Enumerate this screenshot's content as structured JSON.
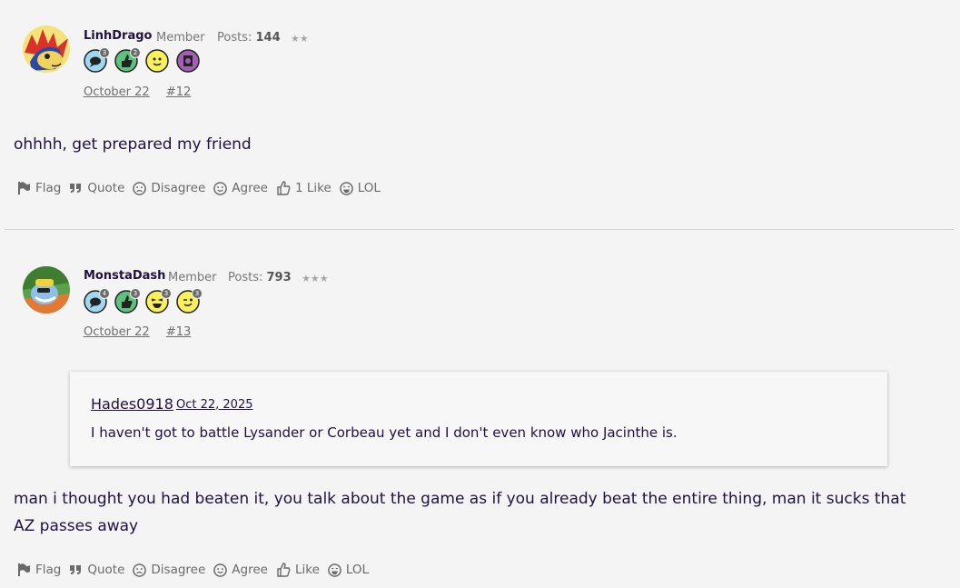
{
  "posts": [
    {
      "username": "LinhDrago",
      "role": "Member",
      "posts_label": "Posts:",
      "posts_count": "144",
      "stars": "★★",
      "badges": [
        {
          "icon": "speech-bubble-badge-icon",
          "count": "3"
        },
        {
          "icon": "thumbs-up-badge-icon",
          "count": "2"
        },
        {
          "icon": "smiley-badge-icon",
          "count": ""
        },
        {
          "icon": "photo-badge-icon",
          "count": ""
        }
      ],
      "date": "October 22",
      "post_number": "#12",
      "message": "ohhhh, get prepared my friend",
      "actions": {
        "flag": "Flag",
        "quote": "Quote",
        "disagree": "Disagree",
        "agree": "Agree",
        "like": "1 Like",
        "lol": "LOL"
      }
    },
    {
      "username": "MonstaDash",
      "role": "Member",
      "posts_label": "Posts:",
      "posts_count": "793",
      "stars": "★★★",
      "badges": [
        {
          "icon": "speech-bubble-badge-icon",
          "count": "4"
        },
        {
          "icon": "thumbs-up-badge-icon",
          "count": "3"
        },
        {
          "icon": "laughing-badge-icon",
          "count": "3"
        },
        {
          "icon": "winking-badge-icon",
          "count": "3"
        }
      ],
      "date": "October 22",
      "post_number": "#13",
      "quote": {
        "author": "Hades0918",
        "date": "Oct 22, 2025",
        "text": "I haven't got to battle Lysander or Corbeau yet and I don't even know who Jacinthe is."
      },
      "message": "man i thought you had beaten it, you talk about the game as if you already beat the entire thing, man it sucks that AZ passes away",
      "actions": {
        "flag": "Flag",
        "quote": "Quote",
        "disagree": "Disagree",
        "agree": "Agree",
        "like": "Like",
        "lol": "LOL"
      }
    }
  ],
  "colors": {
    "background": "#f4f4f4",
    "text": "#1f1140",
    "muted": "#6a6a6a",
    "divider": "#d3d3d3"
  }
}
